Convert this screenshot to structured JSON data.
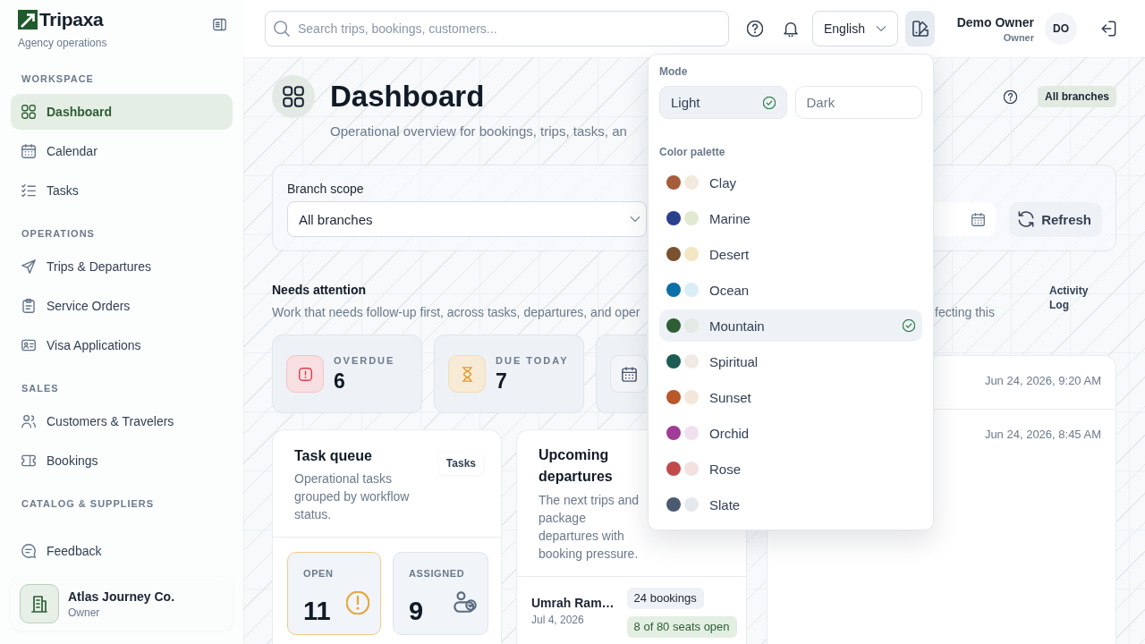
{
  "sidebar": {
    "brand": {
      "name": "Tripaxa",
      "tagline": "Agency operations"
    },
    "sections": [
      {
        "title": "WORKSPACE",
        "items": [
          {
            "label": "Dashboard",
            "selected": true
          },
          {
            "label": "Calendar",
            "selected": false
          },
          {
            "label": "Tasks",
            "selected": false
          }
        ]
      },
      {
        "title": "OPERATIONS",
        "items": [
          {
            "label": "Trips & Departures",
            "selected": false
          },
          {
            "label": "Service Orders",
            "selected": false
          },
          {
            "label": "Visa Applications",
            "selected": false
          }
        ]
      },
      {
        "title": "SALES",
        "items": [
          {
            "label": "Customers & Travelers",
            "selected": false
          },
          {
            "label": "Bookings",
            "selected": false
          }
        ]
      },
      {
        "title": "CATALOG & SUPPLIERS"
      }
    ],
    "footer_link": {
      "label": "Feedback"
    },
    "account": {
      "name": "Atlas Journey Co.",
      "role": "Owner"
    }
  },
  "header": {
    "search": {
      "placeholder": "Search trips, bookings, customers..."
    },
    "language": {
      "value": "English"
    },
    "theme_button": {
      "expanded": true
    },
    "user": {
      "name": "Demo Owner",
      "role": "Owner",
      "initials": "DO"
    }
  },
  "page": {
    "title": "Dashboard",
    "subtitle": "Operational overview for bookings, trips, tasks, an",
    "scope_badge": "All branches"
  },
  "filters": {
    "branch": {
      "label": "Branch scope",
      "value": "All branches"
    },
    "refresh_button": "Refresh"
  },
  "attention": {
    "title": "Needs attention",
    "description": "Work that needs follow-up first, across tasks, departures, and oper",
    "description_continued": "fecting this",
    "stats": [
      {
        "kind": "overdue",
        "label": "OVERDUE",
        "value": "6"
      },
      {
        "kind": "due_today",
        "label": "DUE TODAY",
        "value": "7"
      },
      {
        "kind": "upcoming"
      }
    ]
  },
  "activity_log": {
    "link": "Activity Log",
    "rows": [
      {
        "time": "Jun 24, 2026, 9:20 AM"
      },
      {
        "time": "Jun 24, 2026, 8:45 AM"
      }
    ]
  },
  "task_queue": {
    "title": "Task queue",
    "description": "Operational tasks grouped by workflow status.",
    "link": "Tasks",
    "statuses": [
      {
        "kind": "open",
        "label": "OPEN",
        "value": "11"
      },
      {
        "kind": "assigned",
        "label": "ASSIGNED",
        "value": "9"
      }
    ]
  },
  "upcoming_departures": {
    "title": "Upcoming departures",
    "description": "The next trips and package departures with booking pressure.",
    "rows": [
      {
        "name": "Umrah Ram…",
        "date": "Jul 4, 2026",
        "bookings": "24 bookings",
        "seats": "8 of 80 seats open"
      }
    ]
  },
  "theme_menu": {
    "mode_label": "Mode",
    "modes": [
      {
        "label": "Light",
        "selected": true
      },
      {
        "label": "Dark",
        "selected": false
      }
    ],
    "palette_label": "Color palette",
    "palettes": [
      {
        "name": "Clay",
        "swatches": [
          {
            "color": "#a65d3c"
          },
          {
            "color": "#f3eade"
          }
        ],
        "selected": false
      },
      {
        "name": "Marine",
        "swatches": [
          {
            "color": "#2b3f8f"
          },
          {
            "color": "#e2e9d2"
          }
        ],
        "selected": false
      },
      {
        "name": "Desert",
        "swatches": [
          {
            "color": "#7a5230"
          },
          {
            "color": "#f4e6c3"
          }
        ],
        "selected": false
      },
      {
        "name": "Ocean",
        "swatches": [
          {
            "color": "#0b6fa8"
          },
          {
            "color": "#dbedf6"
          }
        ],
        "selected": false
      },
      {
        "name": "Mountain",
        "swatches": [
          {
            "color": "#2e5e34"
          },
          {
            "color": "#e3e9e3"
          }
        ],
        "selected": true
      },
      {
        "name": "Spiritual",
        "swatches": [
          {
            "color": "#1c5c52"
          },
          {
            "color": "#efebe4"
          }
        ],
        "selected": false
      },
      {
        "name": "Sunset",
        "swatches": [
          {
            "color": "#b8572a"
          },
          {
            "color": "#f5e6da"
          }
        ],
        "selected": false
      },
      {
        "name": "Orchid",
        "swatches": [
          {
            "color": "#a03c98"
          },
          {
            "color": "#f0e0ef"
          }
        ],
        "selected": false
      },
      {
        "name": "Rose",
        "swatches": [
          {
            "color": "#c04a4a"
          },
          {
            "color": "#f3e1e1"
          }
        ],
        "selected": false
      },
      {
        "name": "Slate",
        "swatches": [
          {
            "color": "#4b5a70"
          },
          {
            "color": "#e5e8ec"
          }
        ],
        "selected": false
      }
    ]
  }
}
